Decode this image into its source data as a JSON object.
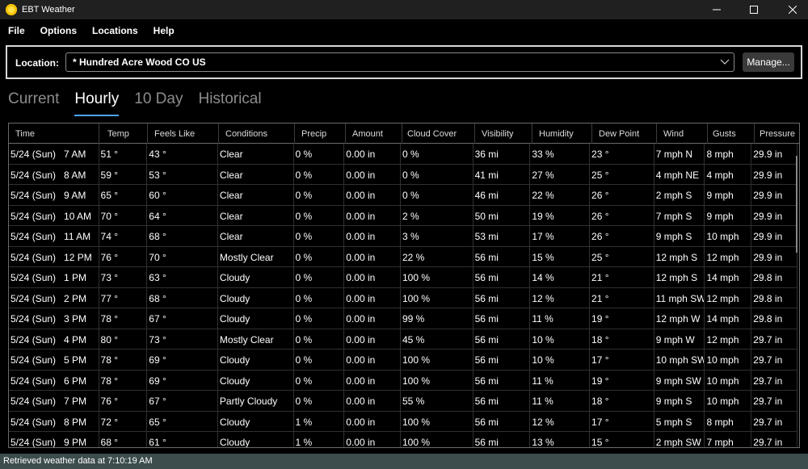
{
  "window": {
    "title": "EBT Weather",
    "icon": "sun-icon"
  },
  "menu": [
    "File",
    "Options",
    "Locations",
    "Help"
  ],
  "location": {
    "label": "Location:",
    "value": "* Hundred Acre Wood CO US",
    "manage_label": "Manage..."
  },
  "tabs": [
    {
      "label": "Current",
      "active": false
    },
    {
      "label": "Hourly",
      "active": true
    },
    {
      "label": "10 Day",
      "active": false
    },
    {
      "label": "Historical",
      "active": false
    }
  ],
  "table": {
    "columns": [
      "Time",
      "Temp",
      "Feels Like",
      "Conditions",
      "Precip",
      "Amount",
      "Cloud Cover",
      "Visibility",
      "Humidity",
      "Dew Point",
      "Wind",
      "Gusts",
      "Pressure"
    ],
    "rows": [
      [
        "5/24 (Sun)   7 AM",
        "51 °",
        "43 °",
        "Clear",
        "0 %",
        "0.00 in",
        "0 %",
        "36 mi",
        "33 %",
        "23 °",
        "7 mph N",
        "8 mph",
        "29.9 in"
      ],
      [
        "5/24 (Sun)   8 AM",
        "59 °",
        "53 °",
        "Clear",
        "0 %",
        "0.00 in",
        "0 %",
        "41 mi",
        "27 %",
        "25 °",
        "4 mph NE",
        "4 mph",
        "29.9 in"
      ],
      [
        "5/24 (Sun)   9 AM",
        "65 °",
        "60 °",
        "Clear",
        "0 %",
        "0.00 in",
        "0 %",
        "46 mi",
        "22 %",
        "26 °",
        "2 mph S",
        "9 mph",
        "29.9 in"
      ],
      [
        "5/24 (Sun)   10 AM",
        "70 °",
        "64 °",
        "Clear",
        "0 %",
        "0.00 in",
        "2 %",
        "50 mi",
        "19 %",
        "26 °",
        "7 mph S",
        "9 mph",
        "29.9 in"
      ],
      [
        "5/24 (Sun)   11 AM",
        "74 °",
        "68 °",
        "Clear",
        "0 %",
        "0.00 in",
        "3 %",
        "53 mi",
        "17 %",
        "26 °",
        "9 mph S",
        "10 mph",
        "29.9 in"
      ],
      [
        "5/24 (Sun)   12 PM",
        "76 °",
        "70 °",
        "Mostly Clear",
        "0 %",
        "0.00 in",
        "22 %",
        "56 mi",
        "15 %",
        "25 °",
        "12 mph S",
        "12 mph",
        "29.9 in"
      ],
      [
        "5/24 (Sun)   1 PM",
        "73 °",
        "63 °",
        "Cloudy",
        "0 %",
        "0.00 in",
        "100 %",
        "56 mi",
        "14 %",
        "21 °",
        "12 mph S",
        "14 mph",
        "29.8 in"
      ],
      [
        "5/24 (Sun)   2 PM",
        "77 °",
        "68 °",
        "Cloudy",
        "0 %",
        "0.00 in",
        "100 %",
        "56 mi",
        "12 %",
        "21 °",
        "11 mph SW",
        "12 mph",
        "29.8 in"
      ],
      [
        "5/24 (Sun)   3 PM",
        "78 °",
        "67 °",
        "Cloudy",
        "0 %",
        "0.00 in",
        "99 %",
        "56 mi",
        "11 %",
        "19 °",
        "12 mph W",
        "14 mph",
        "29.8 in"
      ],
      [
        "5/24 (Sun)   4 PM",
        "80 °",
        "73 °",
        "Mostly Clear",
        "0 %",
        "0.00 in",
        "45 %",
        "56 mi",
        "10 %",
        "18 °",
        "9 mph W",
        "12 mph",
        "29.7 in"
      ],
      [
        "5/24 (Sun)   5 PM",
        "78 °",
        "69 °",
        "Cloudy",
        "0 %",
        "0.00 in",
        "100 %",
        "56 mi",
        "10 %",
        "17 °",
        "10 mph SW",
        "10 mph",
        "29.7 in"
      ],
      [
        "5/24 (Sun)   6 PM",
        "78 °",
        "69 °",
        "Cloudy",
        "0 %",
        "0.00 in",
        "100 %",
        "56 mi",
        "11 %",
        "19 °",
        "9 mph SW",
        "10 mph",
        "29.7 in"
      ],
      [
        "5/24 (Sun)   7 PM",
        "76 °",
        "67 °",
        "Partly Cloudy",
        "0 %",
        "0.00 in",
        "55 %",
        "56 mi",
        "11 %",
        "18 °",
        "9 mph S",
        "10 mph",
        "29.7 in"
      ],
      [
        "5/24 (Sun)   8 PM",
        "72 °",
        "65 °",
        "Cloudy",
        "1 %",
        "0.00 in",
        "100 %",
        "56 mi",
        "12 %",
        "17 °",
        "5 mph S",
        "8 mph",
        "29.7 in"
      ],
      [
        "5/24 (Sun)   9 PM",
        "68 °",
        "61 °",
        "Cloudy",
        "1 %",
        "0.00 in",
        "100 %",
        "56 mi",
        "13 %",
        "15 °",
        "2 mph SW",
        "7 mph",
        "29.7 in"
      ]
    ]
  },
  "status": {
    "text": "Retrieved weather data at 7:10:19 AM"
  },
  "colors": {
    "accent": "#4ea3ff",
    "statusbar": "#3d4d4e",
    "titlebar": "#202020"
  }
}
